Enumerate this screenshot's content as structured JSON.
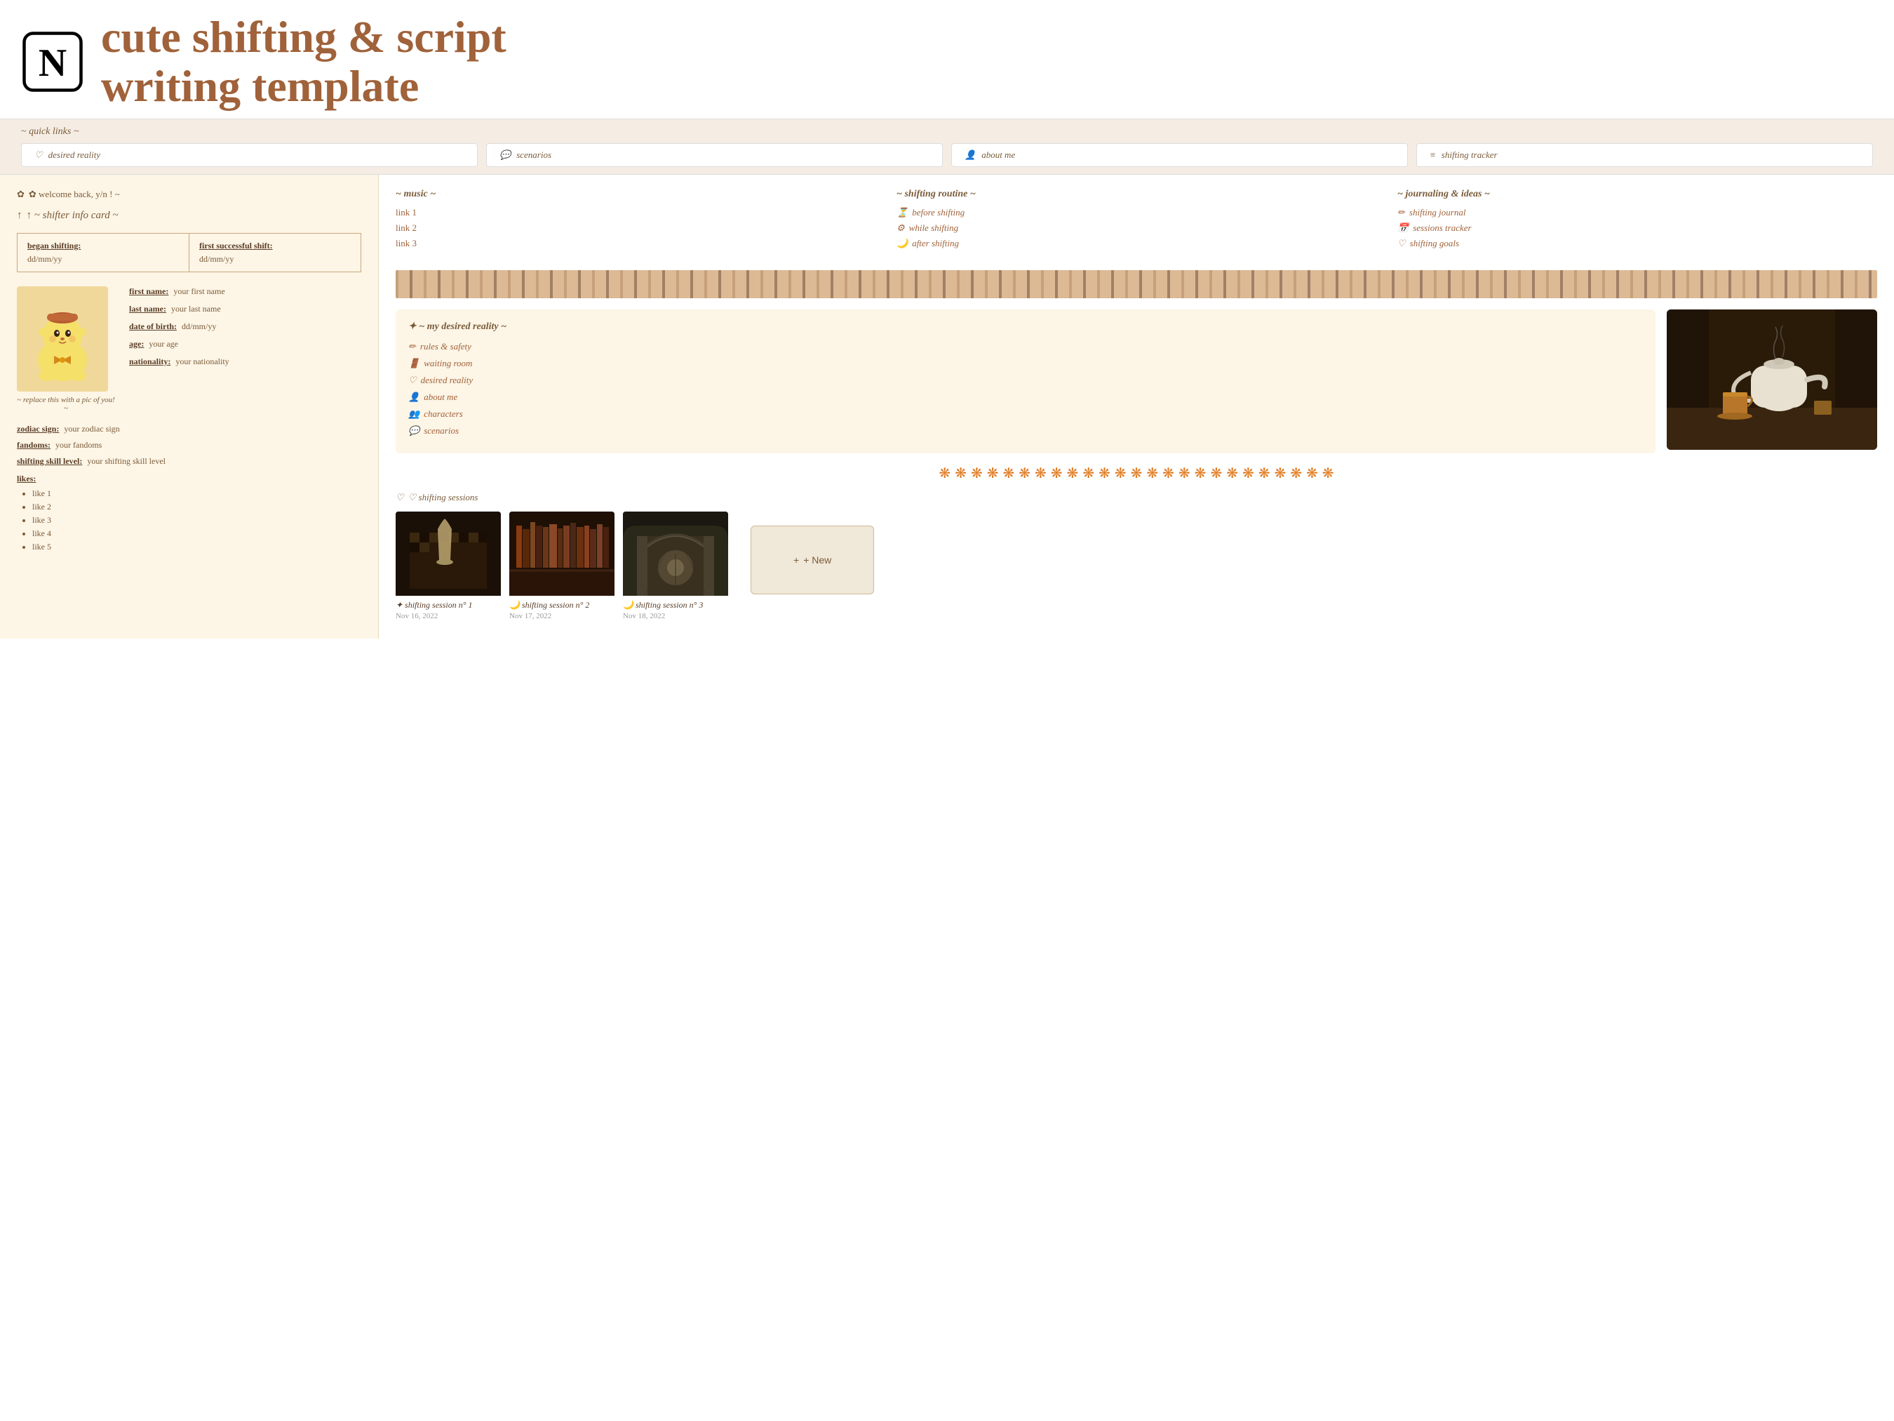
{
  "header": {
    "title_line1": "cute shifting & script",
    "title_line2": "writing template",
    "notion_alt": "Notion Logo"
  },
  "quick_links": {
    "label": "~ quick links ~",
    "items": [
      {
        "icon": "♡",
        "label": "desired reality"
      },
      {
        "icon": "💬",
        "label": "scenarios"
      },
      {
        "icon": "👤",
        "label": "about me"
      },
      {
        "icon": "≡",
        "label": "shifting tracker"
      }
    ]
  },
  "left_panel": {
    "welcome": "✿  welcome back, y/n ! ~",
    "shifter_info_title": "↑  ~ shifter info card ~",
    "began_label": "began shifting:",
    "began_value": "dd/mm/yy",
    "first_shift_label": "first successful shift:",
    "first_shift_value": "dd/mm/yy",
    "profile_caption": "~ replace this with a pic of you! ~",
    "fields": [
      {
        "label": "first name:",
        "value": "your first name"
      },
      {
        "label": "last name:",
        "value": "your last name"
      },
      {
        "label": "date of birth:",
        "value": "dd/mm/yy"
      },
      {
        "label": "age:",
        "value": "your age"
      },
      {
        "label": "nationality:",
        "value": "your nationality"
      }
    ],
    "extra_fields": [
      {
        "label": "zodiac sign:",
        "value": "your zodiac sign"
      },
      {
        "label": "fandoms:",
        "value": "your fandoms"
      },
      {
        "label": "shifting skill level:",
        "value": "your shifting skill level"
      }
    ],
    "likes_label": "likes:",
    "likes": [
      "like 1",
      "like 2",
      "like 3",
      "like 4",
      "like 5"
    ]
  },
  "right_panel": {
    "music": {
      "title": "~ music ~",
      "links": [
        "link 1",
        "link 2",
        "link 3"
      ]
    },
    "shifting_routine": {
      "title": "~ shifting routine ~",
      "items": [
        {
          "icon": "⏳",
          "label": "before shifting"
        },
        {
          "icon": "⚙",
          "label": "while shifting"
        },
        {
          "icon": "🌙",
          "label": "after shifting"
        }
      ]
    },
    "journaling": {
      "title": "~ journaling & ideas ~",
      "items": [
        {
          "icon": "✏",
          "label": "shifting journal"
        },
        {
          "icon": "📅",
          "label": "sessions tracker"
        },
        {
          "icon": "♡",
          "label": "shifting goals"
        }
      ]
    },
    "desired_reality": {
      "title": "✦  ~ my desired reality ~",
      "links": [
        {
          "icon": "✏",
          "label": "rules & safety"
        },
        {
          "icon": "🚪",
          "label": "waiting room"
        },
        {
          "icon": "♡",
          "label": "desired reality"
        },
        {
          "icon": "👤",
          "label": "about me"
        },
        {
          "icon": "👥",
          "label": "characters"
        },
        {
          "icon": "💬",
          "label": "scenarios"
        }
      ]
    },
    "flowers": [
      "❋",
      "❋",
      "❋",
      "❋",
      "❋",
      "❋",
      "❋",
      "❋",
      "❋",
      "❋",
      "❋",
      "❋",
      "❋",
      "❋",
      "❋",
      "❋",
      "❋",
      "❋",
      "❋",
      "❋",
      "❋",
      "❋",
      "❋",
      "❋",
      "❋"
    ],
    "sessions": {
      "label": "♡  shifting sessions",
      "cards": [
        {
          "title": "✦  shifting session n° 1",
          "date": "Nov 16, 2022",
          "image_class": "chess"
        },
        {
          "title": "🌙  shifting session n° 2",
          "date": "Nov 17, 2022",
          "image_class": "books"
        },
        {
          "title": "🌙  shifting session n° 3",
          "date": "Nov 18, 2022",
          "image_class": "arch"
        }
      ],
      "new_label": "+ New"
    }
  }
}
